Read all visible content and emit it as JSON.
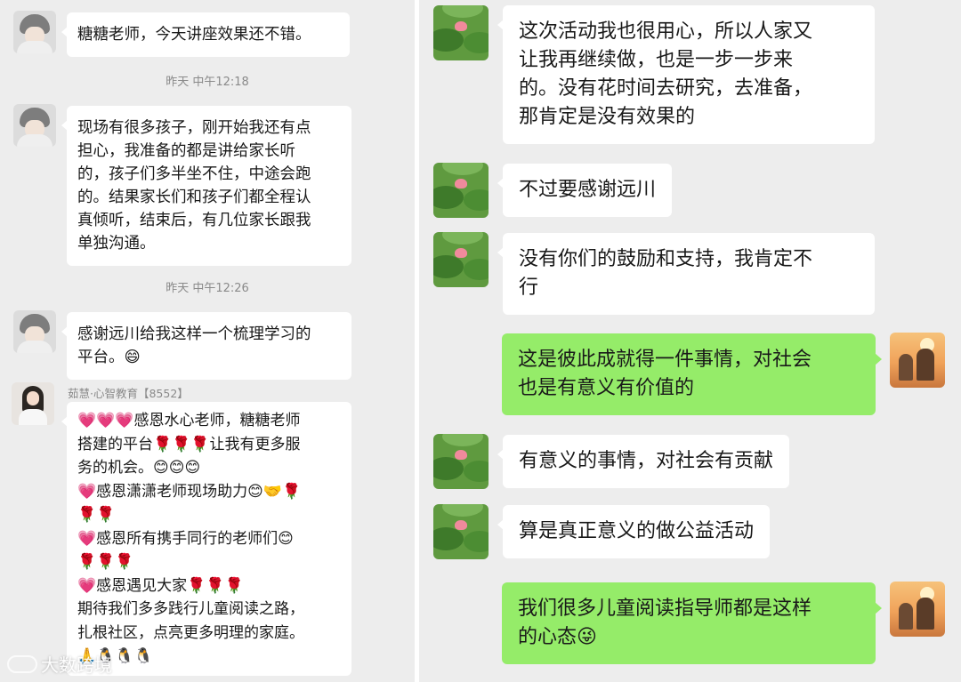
{
  "left_chat": {
    "timestamps": [
      "昨天 中午12:18",
      "昨天 中午12:26"
    ],
    "messages": [
      {
        "text": "糖糖老师，今天讲座效果还不错。"
      },
      {
        "text": "现场有很多孩子，刚开始我还有点\n担心，我准备的都是讲给家长听\n的，孩子们多半坐不住，中途会跑\n的。结果家长们和孩子们都全程认\n真倾听，结束后，有几位家长跟我\n单独沟通。"
      },
      {
        "text": "感谢远川给我这样一个梳理学习的\n平台。😄"
      },
      {
        "sender": "茹慧·心智教育【8552】",
        "text": "💗💗💗感恩水心老师，糖糖老师\n搭建的平台🌹🌹🌹让我有更多服\n务的机会。😊😊😊\n💗感恩潇潇老师现场助力😊🤝🌹\n🌹🌹\n💗感恩所有携手同行的老师们😊\n🌹🌹🌹\n💗感恩遇见大家🌹🌹🌹\n期待我们多多践行儿童阅读之路，\n扎根社区，点亮更多明理的家庭。\n🙏🐧🐧🐧"
      }
    ]
  },
  "right_chat": {
    "messages": [
      {
        "from": "other",
        "text": "这次活动我也很用心，所以人家又\n让我再继续做，也是一步一步来\n的。没有花时间去研究，去准备，\n那肯定是没有效果的"
      },
      {
        "from": "other",
        "text": "不过要感谢远川"
      },
      {
        "from": "other",
        "text": "没有你们的鼓励和支持，我肯定不\n行"
      },
      {
        "from": "self",
        "text": "这是彼此成就得一件事情，对社会\n也是有意义有价值的"
      },
      {
        "from": "other",
        "text": "有意义的事情，对社会有贡献"
      },
      {
        "from": "other",
        "text": "算是真正意义的做公益活动"
      },
      {
        "from": "self",
        "text": "我们很多儿童阅读指导师都是这样\n的心态😜"
      }
    ]
  },
  "watermark": {
    "text": "大数跨境"
  },
  "colors": {
    "background": "#ededed",
    "bubble_other": "#ffffff",
    "bubble_self": "#95ec69",
    "meta_text": "#8a8a8a"
  },
  "icons": {
    "avatar_teacher": "girl-avatar-icon",
    "avatar_ruhui": "woman-avatar-icon",
    "avatar_other": "lotus-avatar-icon",
    "avatar_self": "sunset-avatar-icon"
  }
}
